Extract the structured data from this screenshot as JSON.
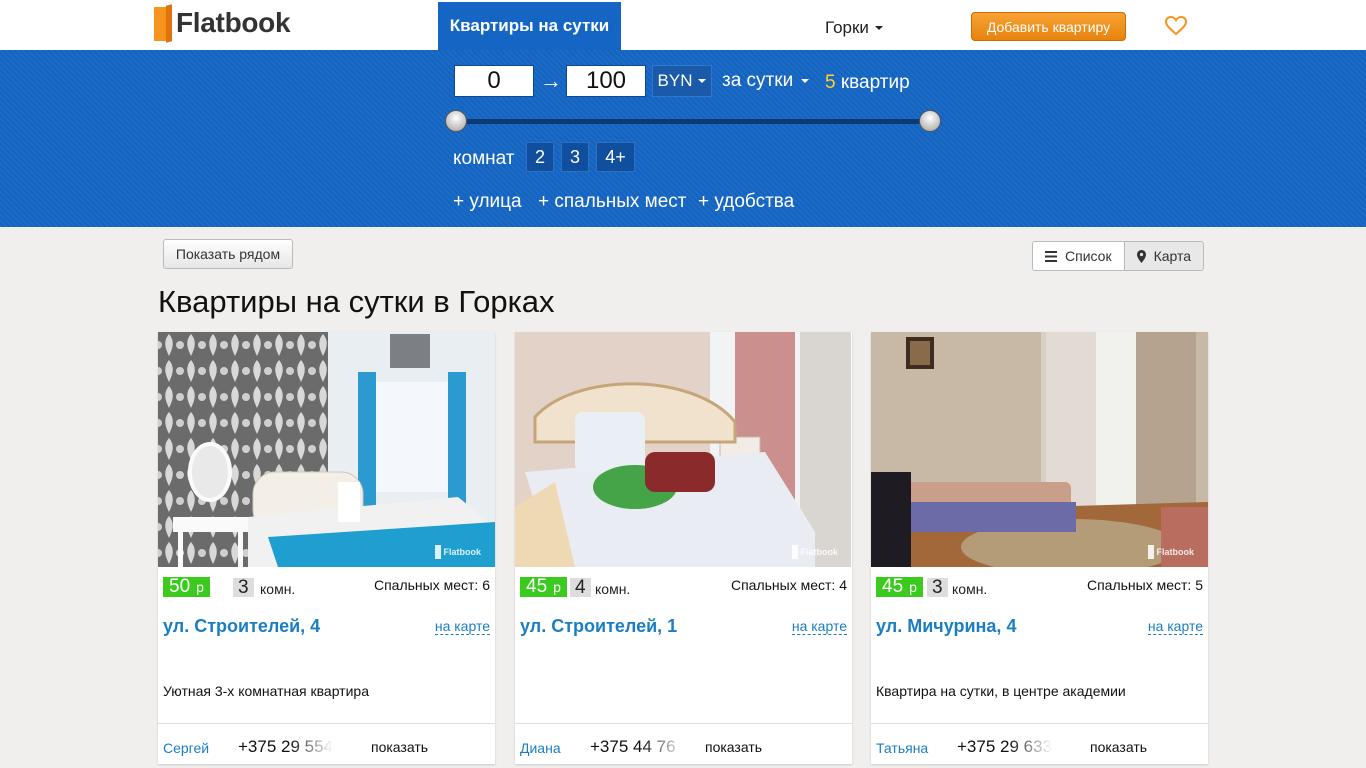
{
  "header": {
    "logo_text": "Flatbook",
    "nav_active": "Квартиры на сутки",
    "city": "Горки",
    "add_button": "Добавить квартиру",
    "brand_color": "#f7941d",
    "nav_color": "#1566c4"
  },
  "filter": {
    "price_from": "0",
    "arrow": "→",
    "price_to": "100",
    "currency": "BYN",
    "period": "за сутки",
    "count_number": "5",
    "count_word": "квартир",
    "rooms_label": "комнат",
    "room_options": [
      "2",
      "3",
      "4+"
    ],
    "extras": [
      "+ улица",
      "+ спальных мест",
      "+ удобства"
    ]
  },
  "toolbar": {
    "near_button": "Показать рядом",
    "view_list": "Список",
    "view_map": "Карта"
  },
  "page_title": "Квартиры на сутки в Горках",
  "listings": [
    {
      "price": "50",
      "price_currency": "р",
      "rooms": "3",
      "rooms_word": "комн.",
      "beds": "Спальных мест: 6",
      "address": "ул. Строителей, 4",
      "map_link": "на карте",
      "description": "Уютная 3-х комнатная квартира",
      "owner": "Сергей",
      "phone": "+375 29 554",
      "show": "показать",
      "watermark": "Flatbook"
    },
    {
      "price": "45",
      "price_currency": "р",
      "rooms": "4",
      "rooms_word": "комн.",
      "beds": "Спальных мест: 4",
      "address": "ул. Строителей, 1",
      "map_link": "на карте",
      "description": "",
      "owner": "Диана",
      "phone": "+375 44 76",
      "show": "показать",
      "watermark": "Flatbook"
    },
    {
      "price": "45",
      "price_currency": "р",
      "rooms": "3",
      "rooms_word": "комн.",
      "beds": "Спальных мест: 5",
      "address": "ул. Мичурина, 4",
      "map_link": "на карте",
      "description": "Квартира на сутки, в центре академии",
      "owner": "Татьяна",
      "phone": "+375 29 633",
      "show": "показать",
      "watermark": "Flatbook"
    }
  ]
}
